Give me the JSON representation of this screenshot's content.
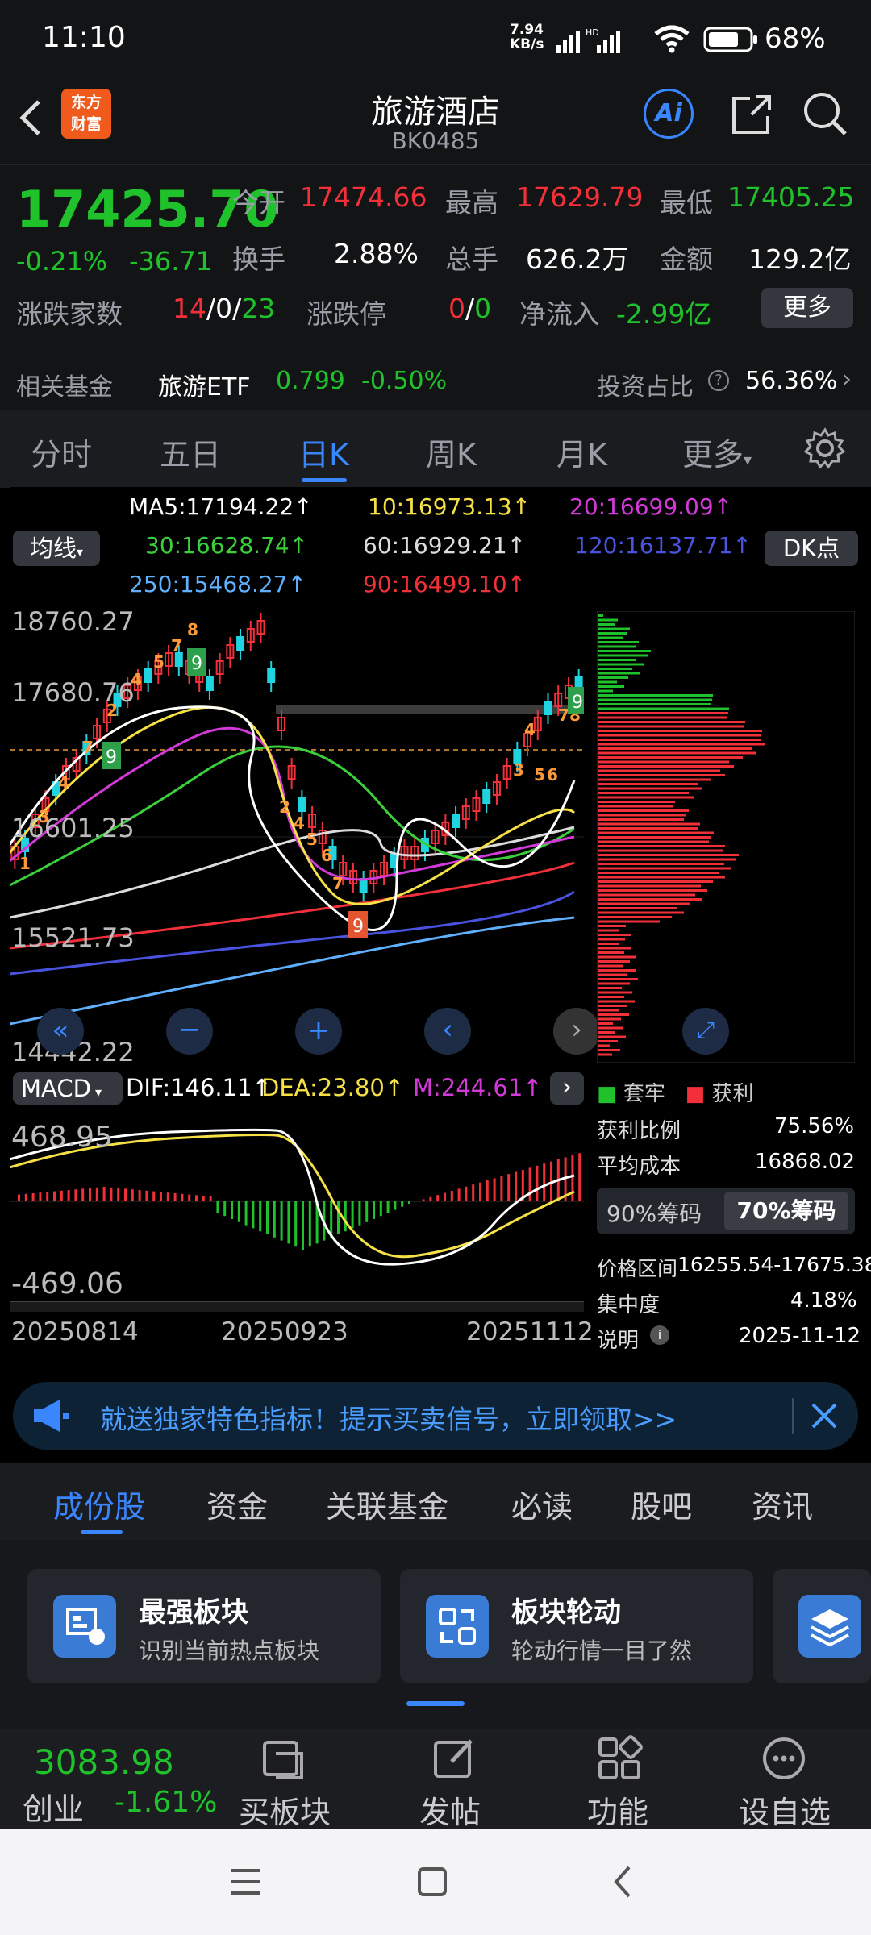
{
  "status": {
    "time": "11:10",
    "net_speed": "7.94",
    "net_unit": "KB/s",
    "hd": "HD",
    "battery": "68%"
  },
  "header": {
    "logo_line1": "东方",
    "logo_line2": "财富",
    "title": "旅游酒店",
    "code": "BK0485",
    "ai_label": "Ai"
  },
  "quote": {
    "price": "17425.70",
    "change_pct": "-0.21%",
    "change": "-36.71",
    "open_label": "今开",
    "open": "17474.66",
    "high_label": "最高",
    "high": "17629.79",
    "low_label": "最低",
    "low": "17405.25",
    "turnover_label": "换手",
    "turnover": "2.88%",
    "volume_label": "总手",
    "volume": "626.2万",
    "amount_label": "金额",
    "amount": "129.2亿",
    "updown_label": "涨跌家数",
    "up": "14",
    "flat": "0",
    "down": "23",
    "limit_label": "涨跌停",
    "limit_up": "0",
    "limit_down": "0",
    "netflow_label": "净流入",
    "netflow": "-2.99亿",
    "more": "更多"
  },
  "fund": {
    "label": "相关基金",
    "name": "旅游ETF",
    "price": "0.799",
    "pct": "-0.50%",
    "ratio_label": "投资占比",
    "ratio": "56.36%"
  },
  "tabs": [
    "分时",
    "五日",
    "日K",
    "周K",
    "月K",
    "更多"
  ],
  "active_tab": 2,
  "ma": {
    "selector": "均线",
    "dk": "DK点",
    "ma5": "MA5:17194.22↑",
    "ma10": "10:16973.13↑",
    "ma20": "20:16699.09↑",
    "ma30": "30:16628.74↑",
    "ma60": "60:16929.21↑",
    "ma120": "120:16137.71↑",
    "ma250": "250:15468.27↑",
    "ma90": "90:16499.10↑"
  },
  "price_axis": [
    "18760.27",
    "17680.76",
    "16601.25",
    "15521.73",
    "14442.22"
  ],
  "macd": {
    "selector": "MACD",
    "dif": "DIF:146.11↑",
    "dea": "DEA:23.80↑",
    "m": "M:244.61↑",
    "top": "468.95",
    "bottom": "-469.06"
  },
  "dates": [
    "20250814",
    "20250923",
    "20251112"
  ],
  "chip": {
    "legend_trapped": "套牢",
    "legend_profit": "获利",
    "rows": [
      [
        "获利比例",
        "75.56%"
      ],
      [
        "平均成本",
        "16868.02"
      ]
    ],
    "tab90": "90%筹码",
    "tab70": "70%筹码",
    "rows2": [
      [
        "价格区间",
        "16255.54-17675.38"
      ],
      [
        "集中度",
        "4.18%"
      ],
      [
        "说明",
        "2025-11-12"
      ]
    ]
  },
  "banner": {
    "text": "就送独家特色指标！提示买卖信号，立即领取>>"
  },
  "sections": [
    "成份股",
    "资金",
    "关联基金",
    "必读",
    "股吧",
    "资讯"
  ],
  "cards": [
    {
      "title": "最强板块",
      "sub": "识别当前热点板块"
    },
    {
      "title": "板块轮动",
      "sub": "轮动行情一目了然"
    }
  ],
  "bottom": {
    "index_value": "3083.98",
    "index_name": "创业",
    "index_pct": "-1.61%",
    "buy": "买板块",
    "post": "发帖",
    "func": "功能",
    "watch": "设自选"
  },
  "colors": {
    "up": "#f2303a",
    "down": "#1fc22b",
    "accent": "#3a7bd5"
  },
  "chart_data": {
    "type": "candlestick",
    "price_ticks": [
      18760.27,
      17680.76,
      16601.25,
      15521.73,
      14442.22
    ],
    "last_close": 17425.7,
    "x_labels": [
      "20250814",
      "20250923",
      "20251112"
    ]
  }
}
